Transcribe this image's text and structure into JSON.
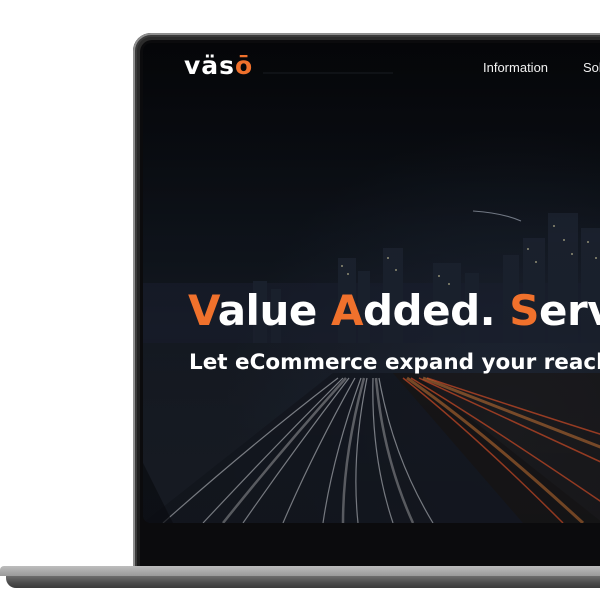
{
  "site": {
    "logo_text": "vaso",
    "logo_prefix": "väs",
    "logo_suffix": "ō"
  },
  "nav": {
    "items": [
      {
        "label": "Information"
      },
      {
        "label": "Sol"
      }
    ]
  },
  "hero": {
    "title_parts": [
      "V",
      "alue ",
      "A",
      "dded. ",
      "S",
      "erv"
    ],
    "subtitle": "Let eCommerce expand your reach."
  },
  "colors": {
    "accent": "#f0712c",
    "text": "#ffffff",
    "bezel": "#1b1b1b"
  }
}
